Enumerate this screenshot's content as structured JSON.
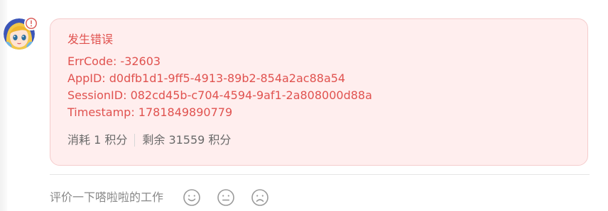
{
  "error": {
    "title": "发生错误",
    "lines": [
      "ErrCode: -32603",
      "AppID: d0dfb1d1-9ff5-4913-89b2-854a2ac88a54",
      "SessionID: 082cd45b-c704-4594-9af1-2a808000d88a",
      "Timestamp: 1781849890779"
    ]
  },
  "usage": {
    "consumed": "消耗 1 积分",
    "remaining": "剩余 31559 积分"
  },
  "rating": {
    "label": "评价一下嗒啦啦的工作",
    "options": [
      "smile-icon",
      "neutral-face-icon",
      "frown-icon"
    ]
  },
  "colors": {
    "error_text": "#e0524f",
    "error_bg": "#ffeeee",
    "error_border": "#f5cccc",
    "muted_text": "#888888"
  },
  "avatar": {
    "icon": "anime-avatar-icon",
    "badge_icon": "warning-circle-icon"
  }
}
